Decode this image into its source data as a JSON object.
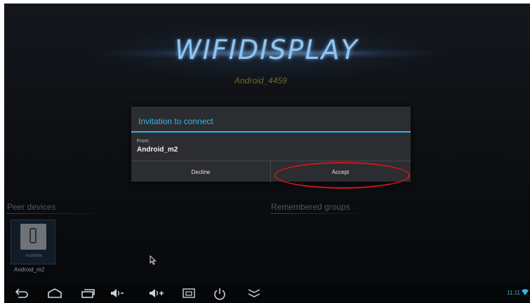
{
  "app": {
    "logo_text": "WIFIDISPLAY",
    "device_name": "Android_4459"
  },
  "dialog": {
    "title": "Invitation to connect",
    "from_label": "From:",
    "from_value": "Android_m2",
    "decline_label": "Decline",
    "accept_label": "Accept"
  },
  "sections": {
    "peer_devices_title": "Peer devices",
    "remembered_groups_title": "Remembered groups"
  },
  "peers": [
    {
      "name": "Android_m2",
      "status": "Available",
      "icon": "phone-icon"
    }
  ],
  "navbar": {
    "icons": [
      "back-icon",
      "home-icon",
      "recent-apps-icon",
      "volume-down-icon",
      "volume-up-icon",
      "screenshot-icon",
      "power-icon",
      "collapse-icon"
    ],
    "clock": "11:11"
  },
  "colors": {
    "accent": "#33b5e5",
    "highlight_ellipse": "#d01818",
    "device_name": "#6f6a28"
  }
}
